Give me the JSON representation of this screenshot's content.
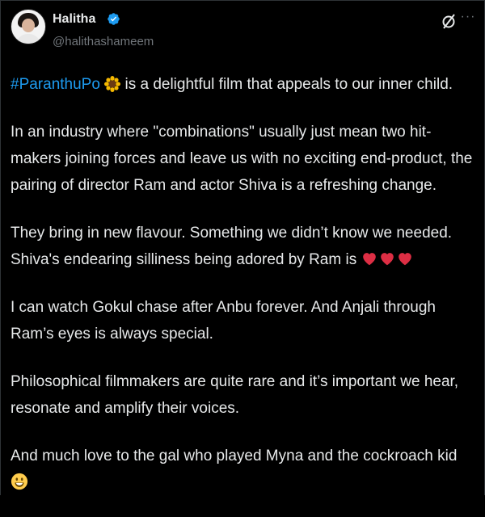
{
  "author": {
    "name": "Halitha",
    "handle": "@halithashameem",
    "verified": true
  },
  "icons": {
    "verified": "verified-badge-icon",
    "grok": "grok-icon",
    "more": "more-icon",
    "sunflower": "sunflower-emoji",
    "heart": "red-heart-emoji",
    "smile": "smiling-face-emoji"
  },
  "colors": {
    "background": "#000000",
    "text": "#e7e9ea",
    "muted": "#71767b",
    "link": "#1d9bf0",
    "verified": "#1d9bf0"
  },
  "post": {
    "hashtag": "#ParanthuPo",
    "line1_rest": " is a delightful film that appeals to our inner child.",
    "para2": "In an industry where \"combinations\" usually just mean two hit-makers joining forces and leave us with no exciting end-product,  the pairing of director Ram and actor Shiva is a refreshing change.",
    "para3_line1": "They bring in new flavour. Something we didn’t know we needed.",
    "para3_line2": "Shiva's endearing silliness being adored by Ram is ",
    "para4": "I can watch Gokul chase after Anbu forever. And Anjali through Ram’s eyes is always special.",
    "para5": "Philosophical filmmakers are quite rare and it’s important we hear, resonate and amplify their voices.",
    "para6": "And much love to the gal who played Myna and the cockroach kid "
  }
}
